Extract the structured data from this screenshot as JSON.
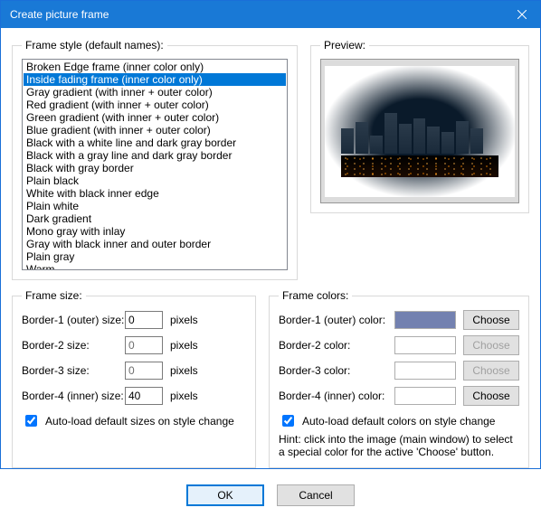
{
  "window": {
    "title": "Create picture frame"
  },
  "frame_style": {
    "label": "Frame style (default names):",
    "selected_index": 1,
    "items": [
      "Broken Edge frame (inner color only)",
      "Inside fading frame (inner color only)",
      "Gray gradient (with inner + outer color)",
      "Red gradient (with inner + outer color)",
      "Green gradient (with inner + outer color)",
      "Blue gradient (with inner + outer color)",
      "Black with a white line and dark gray border",
      "Black with a gray line and dark gray border",
      "Black with gray border",
      "Plain black",
      "White with black inner edge",
      "Plain white",
      "Dark gradient",
      "Mono gray with inlay",
      "Gray with black inner and outer border",
      "Plain gray",
      "Warm"
    ]
  },
  "preview": {
    "label": "Preview:"
  },
  "frame_size": {
    "legend": "Frame size:",
    "rows": [
      {
        "label": "Border-1 (outer) size:",
        "value": "0",
        "enabled": true
      },
      {
        "label": "Border-2 size:",
        "value": "0",
        "enabled": false
      },
      {
        "label": "Border-3 size:",
        "value": "0",
        "enabled": false
      },
      {
        "label": "Border-4 (inner) size:",
        "value": "40",
        "enabled": true
      }
    ],
    "unit": "pixels",
    "auto_label": "Auto-load default sizes on style change",
    "auto_checked": true
  },
  "frame_colors": {
    "legend": "Frame colors:",
    "rows": [
      {
        "label": "Border-1 (outer) color:",
        "swatch": "#7381b0",
        "enabled": true
      },
      {
        "label": "Border-2 color:",
        "swatch": "#ffffff",
        "enabled": false
      },
      {
        "label": "Border-3 color:",
        "swatch": "#ffffff",
        "enabled": false
      },
      {
        "label": "Border-4 (inner) color:",
        "swatch": "#ffffff",
        "enabled": true
      }
    ],
    "choose_label": "Choose",
    "auto_label": "Auto-load default colors on style change",
    "auto_checked": true,
    "hint": "Hint: click into the image (main window) to select a special color for the active 'Choose' button."
  },
  "buttons": {
    "ok": "OK",
    "cancel": "Cancel"
  }
}
